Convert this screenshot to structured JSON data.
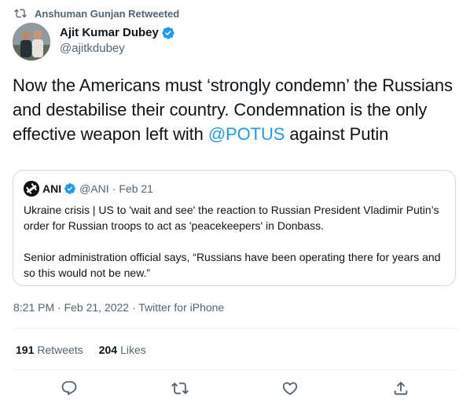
{
  "retweet_banner": {
    "text": "Anshuman Gunjan Retweeted",
    "icon": "retweet-icon"
  },
  "author": {
    "name": "Ajit Kumar Dubey",
    "handle": "@ajitkdubey",
    "verified": true
  },
  "tweet": {
    "text_before": "Now the Americans must ‘strongly condemn’ the Russians and destabilise their country. Condemnation is the only effective weapon left with ",
    "mention": "@POTUS",
    "text_after": " against Putin"
  },
  "quoted_tweet": {
    "name": "ANI",
    "handle": "@ANI",
    "separator": "·",
    "date": "Feb 21",
    "paragraph1": "Ukraine crisis | US to 'wait and see' the reaction to Russian President Vladimir Putin’s order for Russian troops to act as 'peacekeepers' in Donbass.",
    "paragraph2": "Senior administration official says, “Russians have been operating there for years and so this would not be new.”"
  },
  "meta": {
    "timestamp": "8:21 PM · Feb 21, 2022 · Twitter for iPhone"
  },
  "stats": {
    "retweets_count": "191",
    "retweets_label": "Retweets",
    "likes_count": "204",
    "likes_label": "Likes"
  },
  "actions": [
    "reply-icon",
    "retweet-icon",
    "like-icon",
    "share-icon"
  ],
  "colors": {
    "accent": "#1d9bf0",
    "muted": "#536471",
    "text": "#0f1419",
    "border": "#cfd9de"
  }
}
